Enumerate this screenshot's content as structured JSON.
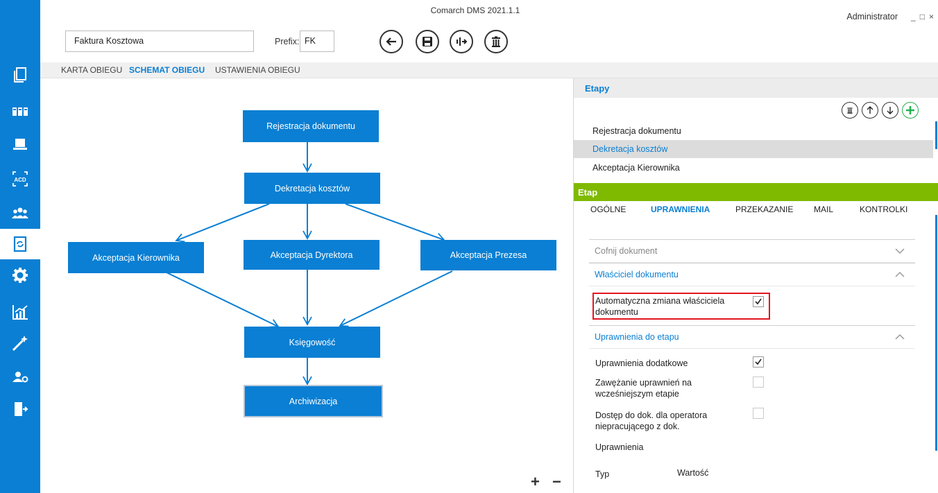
{
  "window": {
    "title": "Comarch DMS 2021.1.1",
    "user": "Administrator",
    "controls": [
      "_",
      "□",
      "×"
    ]
  },
  "sidebar": {
    "items": [
      {
        "icon": "documents-icon"
      },
      {
        "icon": "kanban-icon"
      },
      {
        "icon": "laptop-icon"
      },
      {
        "icon": "ocr-icon",
        "label": "ACD"
      },
      {
        "icon": "users-icon"
      },
      {
        "icon": "workflow-document-icon",
        "active": true
      },
      {
        "icon": "gear-icon"
      },
      {
        "icon": "chart-icon"
      },
      {
        "icon": "magic-wand-icon"
      },
      {
        "icon": "user-settings-icon"
      },
      {
        "icon": "exit-icon"
      }
    ]
  },
  "form": {
    "name_value": "Faktura Kosztowa",
    "prefix_label": "Prefix:",
    "prefix_value": "FK"
  },
  "toolbar": [
    "back-icon",
    "save-icon",
    "publish-icon",
    "delete-icon"
  ],
  "tabs": [
    {
      "label": "KARTA OBIEGU",
      "active": false
    },
    {
      "label": "SCHEMAT OBIEGU",
      "active": true
    },
    {
      "label": "USTAWIENIA OBIEGU",
      "active": false
    }
  ],
  "diagram": {
    "nodes": {
      "rejestracja": "Rejestracja dokumentu",
      "dekretacja": "Dekretacja kosztów",
      "kierownik": "Akceptacja Kierownika",
      "dyrektor": "Akceptacja Dyrektora",
      "prezes": "Akceptacja Prezesa",
      "ksiegowosc": "Księgowość",
      "archiwizacja": "Archiwizacja"
    },
    "zoom_in": "+",
    "zoom_out": "−"
  },
  "etapy": {
    "header": "Etapy",
    "items": [
      "Rejestracja dokumentu",
      "Dekretacja kosztów",
      "Akceptacja Kierownika"
    ],
    "selected": "Dekretacja kosztów"
  },
  "etap": {
    "header": "Etap",
    "subtabs": [
      "OGÓLNE",
      "UPRAWNIENIA",
      "PRZEKAZANIE",
      "MAIL",
      "KONTROLKI"
    ],
    "active_subtab": "UPRAWNIENIA",
    "sections": {
      "cofnij": "Cofnij dokument",
      "wlasciciel": "Właściciel dokumentu",
      "uprawnienia_etap": "Uprawnienia do etapu"
    },
    "auto_owner_label": "Automatyczna zmiana właściciela dokumentu",
    "auto_owner_checked": true,
    "fields": [
      {
        "label": "Uprawnienia dodatkowe",
        "checked": true
      },
      {
        "label": "Zawężanie uprawnień na wcześniejszym etapie",
        "checked": false
      },
      {
        "label": "Dostęp do dok. dla operatora niepracującego z dok.",
        "checked": false
      }
    ],
    "uprawnienia_label": "Uprawnienia",
    "columns": [
      "Typ",
      "Wartość"
    ]
  }
}
